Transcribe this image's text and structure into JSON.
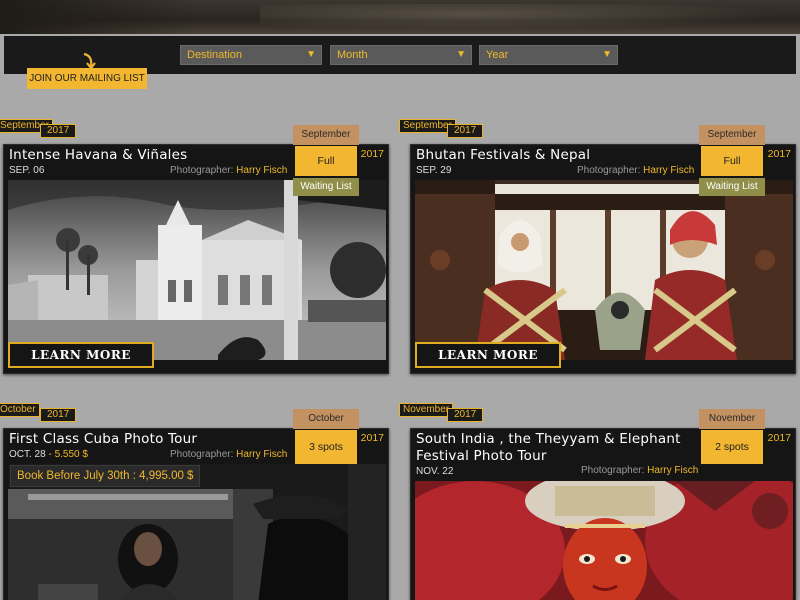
{
  "filters": {
    "destination": "Destination",
    "month": "Month",
    "year": "Year"
  },
  "mailing": {
    "label": "JOIN OUR MAILING LIST"
  },
  "learn_more_label": "LEARN MORE",
  "photographer_prefix": "Photographer:",
  "cards": [
    {
      "month_tag": "September",
      "year_tag": "2017",
      "title": "Intense Havana & Viñales",
      "date": "SEP. 06",
      "photographer": "Harry Fisch",
      "status_month": "September",
      "status": "Full",
      "waiting": "Waiting List",
      "year": "2017"
    },
    {
      "month_tag": "September",
      "year_tag": "2017",
      "title": "Bhutan Festivals & Nepal",
      "date": "SEP. 29",
      "photographer": "Harry Fisch",
      "status_month": "September",
      "status": "Full",
      "waiting": "Waiting List",
      "year": "2017"
    },
    {
      "month_tag": "October",
      "year_tag": "2017",
      "title": "First Class Cuba Photo Tour",
      "date": "OCT. 28",
      "price": "5.550 $",
      "photographer": "Harry Fisch",
      "status_month": "October",
      "status": "3 spots",
      "year": "2017",
      "promo": "Book Before July 30th : 4,995.00 $"
    },
    {
      "month_tag": "November",
      "year_tag": "2017",
      "title_line1": "South India , the Theyyam & Elephant",
      "title_line2": "Festival Photo Tour",
      "date": "NOV. 22",
      "photographer": "Harry Fisch",
      "status_month": "November",
      "status": "2 spots",
      "year": "2017"
    }
  ]
}
